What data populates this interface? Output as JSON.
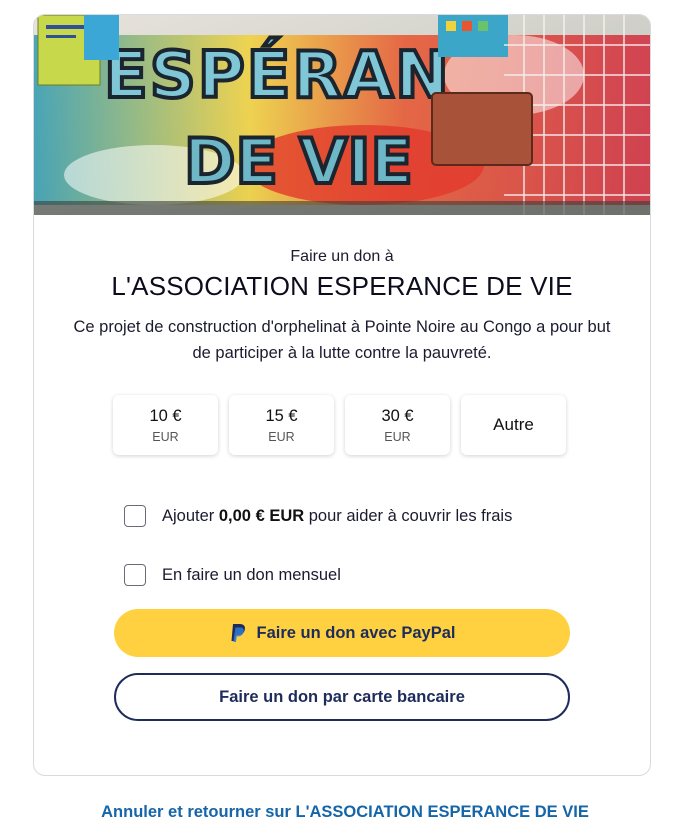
{
  "banner": {
    "graffiti_text": "ESPÉRANCE DE VIE"
  },
  "donation": {
    "eyebrow": "Faire un don à",
    "organization": "L'ASSOCIATION ESPERANCE DE VIE",
    "description": "Ce projet de construction d'orphelinat à Pointe Noire au Congo a pour but de participer à la lutte contre la pauvreté."
  },
  "amounts": [
    {
      "value": "10 €",
      "currency": "EUR"
    },
    {
      "value": "15 €",
      "currency": "EUR"
    },
    {
      "value": "30 €",
      "currency": "EUR"
    },
    {
      "value": "Autre",
      "currency": ""
    }
  ],
  "options": {
    "fees_prefix": "Ajouter ",
    "fees_amount": "0,00 € EUR",
    "fees_suffix": " pour aider à couvrir les frais",
    "fees_checked": false,
    "monthly_label": "En faire un don mensuel",
    "monthly_checked": false
  },
  "buttons": {
    "paypal": "Faire un don avec PayPal",
    "card": "Faire un don par carte bancaire"
  },
  "cancel": {
    "label": "Annuler et retourner sur L'ASSOCIATION ESPERANCE DE VIE"
  },
  "colors": {
    "paypal_yellow": "#ffd140",
    "navy": "#1d2c5b",
    "link_blue": "#1565a8"
  }
}
